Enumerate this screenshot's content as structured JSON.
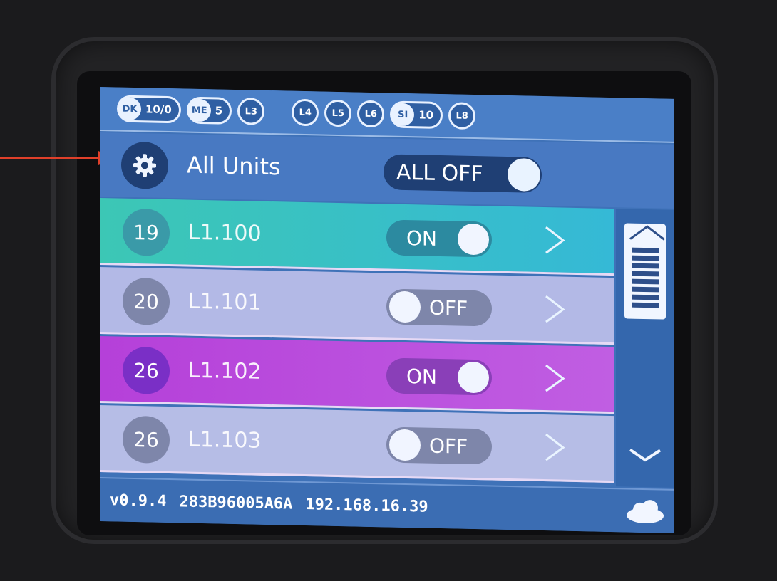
{
  "statusbar": {
    "pills": [
      {
        "knob": "DK",
        "value": "10/0"
      },
      {
        "knob": "ME",
        "value": "5"
      }
    ],
    "circles_left": [
      "L3"
    ],
    "circles_right": [
      "L4",
      "L5",
      "L6"
    ],
    "pill_si": {
      "knob": "SI",
      "value": "10"
    },
    "circle_last": "L8"
  },
  "all_units": {
    "label": "All Units",
    "toggle_label": "ALL OFF"
  },
  "units": [
    {
      "id": "19",
      "name": "L1.100",
      "state": "ON"
    },
    {
      "id": "20",
      "name": "L1.101",
      "state": "OFF"
    },
    {
      "id": "26",
      "name": "L1.102",
      "state": "ON"
    },
    {
      "id": "26",
      "name": "L1.103",
      "state": "OFF"
    }
  ],
  "footer": {
    "version": "v0.9.4",
    "serial": "283B96005A6A",
    "ip": "192.168.16.39"
  },
  "icons": {
    "settings": "gear-icon",
    "chevron": "chevron-right-icon",
    "scroll_up": "chevron-up-icon",
    "scroll_down": "chevron-down-icon",
    "cloud": "cloud-icon"
  },
  "colors": {
    "screen_blue": "#3f72b8",
    "teal_row": "#3cc7b5",
    "lavender_row": "#b3b9e6",
    "purple_row": "#b540d9",
    "annotation_arrow": "#e0402a"
  }
}
